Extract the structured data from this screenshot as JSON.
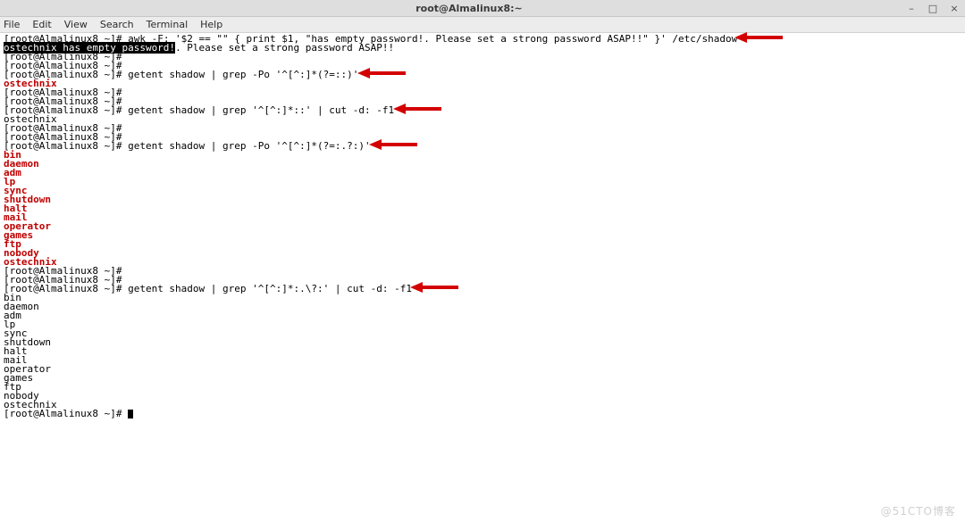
{
  "title": "root@Almalinux8:~",
  "menubar": [
    "File",
    "Edit",
    "View",
    "Search",
    "Terminal",
    "Help"
  ],
  "window_controls": {
    "min": "–",
    "max": "□",
    "close": "×"
  },
  "prompt": "[root@Almalinux8 ~]#",
  "lines": [
    {
      "prompt": true,
      "cmd": "awk -F: '$2 == \"\" { print $1, \"has empty password!. Please set a strong password ASAP!!\" }' /etc/shadow",
      "arrow": true
    },
    {
      "hl": "ostechnix has empty password!",
      "rest": ". Please set a strong password ASAP!!"
    },
    {
      "prompt": true,
      "cmd": ""
    },
    {
      "prompt": true,
      "cmd": ""
    },
    {
      "prompt": true,
      "cmd": "getent shadow | grep -Po '^[^:]*(?=::)'",
      "arrow": true
    },
    {
      "red": "ostechnix"
    },
    {
      "prompt": true,
      "cmd": ""
    },
    {
      "prompt": true,
      "cmd": ""
    },
    {
      "prompt": true,
      "cmd": "getent shadow | grep '^[^:]*::' | cut -d: -f1",
      "arrow": true
    },
    {
      "plain": "ostechnix"
    },
    {
      "prompt": true,
      "cmd": ""
    },
    {
      "prompt": true,
      "cmd": ""
    },
    {
      "prompt": true,
      "cmd": "getent shadow | grep -Po '^[^:]*(?=:.?:)'",
      "arrow": true
    },
    {
      "red": "bin"
    },
    {
      "red": "daemon"
    },
    {
      "red": "adm"
    },
    {
      "red": "lp"
    },
    {
      "red": "sync"
    },
    {
      "red": "shutdown"
    },
    {
      "red": "halt"
    },
    {
      "red": "mail"
    },
    {
      "red": "operator"
    },
    {
      "red": "games"
    },
    {
      "red": "ftp"
    },
    {
      "red": "nobody"
    },
    {
      "red": "ostechnix"
    },
    {
      "prompt": true,
      "cmd": ""
    },
    {
      "prompt": true,
      "cmd": ""
    },
    {
      "prompt": true,
      "cmd": "getent shadow | grep '^[^:]*:.\\?:' | cut -d: -f1",
      "arrow": true
    },
    {
      "plain": "bin"
    },
    {
      "plain": "daemon"
    },
    {
      "plain": "adm"
    },
    {
      "plain": "lp"
    },
    {
      "plain": "sync"
    },
    {
      "plain": "shutdown"
    },
    {
      "plain": "halt"
    },
    {
      "plain": "mail"
    },
    {
      "plain": "operator"
    },
    {
      "plain": "games"
    },
    {
      "plain": "ftp"
    },
    {
      "plain": "nobody"
    },
    {
      "plain": "ostechnix"
    },
    {
      "prompt": true,
      "cmd": "",
      "cursor": true
    }
  ],
  "watermark": "@51CTO博客"
}
